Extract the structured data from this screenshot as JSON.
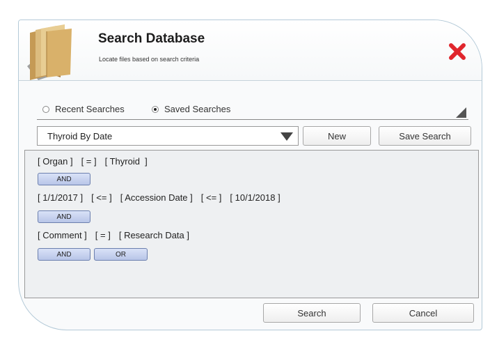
{
  "dialog": {
    "title": "Search Database",
    "subtitle": "Locate files based on search criteria",
    "close_icon": "close-x-icon",
    "folder_icon": "folder-icon"
  },
  "tabs": {
    "recent_label": "Recent Searches",
    "saved_label": "Saved Searches",
    "selected": "Saved Searches"
  },
  "saved_search": {
    "selected_value": "Thyroid By Date",
    "new_label": "New",
    "save_label": "Save Search"
  },
  "criteria": {
    "row1": {
      "field": "[ Organ ]",
      "op": "[ = ]",
      "value": "[ Thyroid  ]"
    },
    "logic1": "AND",
    "row2": {
      "low": "[ 1/1/2017 ]",
      "op1": "[ <= ]",
      "field": "[ Accession Date ]",
      "op2": "[ <= ]",
      "high": "[ 10/1/2018 ]"
    },
    "logic2": "AND",
    "row3": {
      "field": "[ Comment ]",
      "op": "[ = ]",
      "value": "[ Research Data ]"
    },
    "logic3_and": "AND",
    "logic3_or": "OR"
  },
  "footer": {
    "search_label": "Search",
    "cancel_label": "Cancel"
  },
  "colors": {
    "close": "#e0262d",
    "logic_button": "#c7d2ef",
    "folder": "#d7b473"
  }
}
